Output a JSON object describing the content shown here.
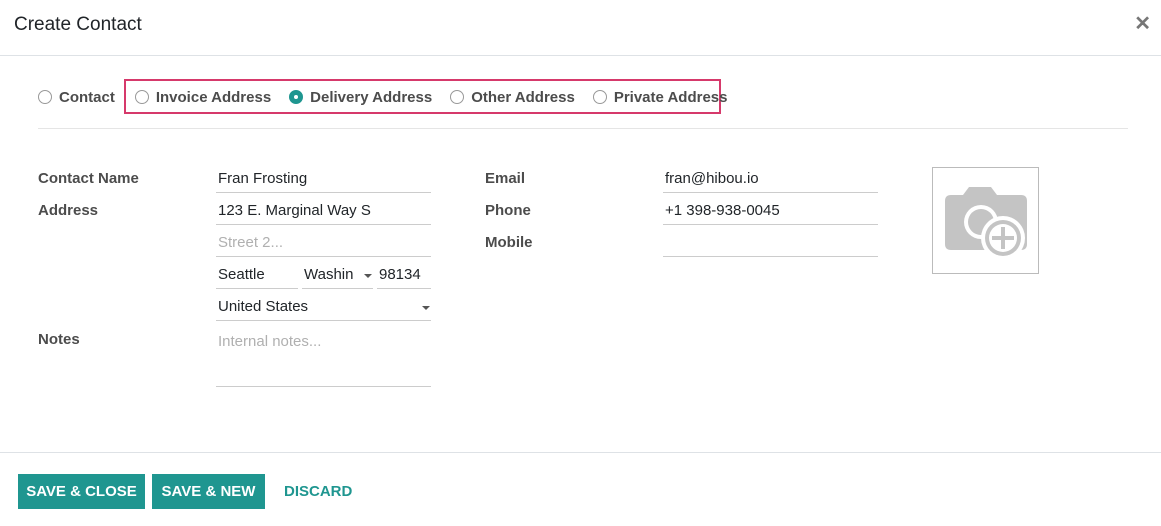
{
  "dialog": {
    "title": "Create Contact",
    "close_icon": "close-icon"
  },
  "address_types": [
    {
      "label": "Contact",
      "checked": false
    },
    {
      "label": "Invoice Address",
      "checked": false
    },
    {
      "label": "Delivery Address",
      "checked": true
    },
    {
      "label": "Other Address",
      "checked": false
    },
    {
      "label": "Private Address",
      "checked": false
    }
  ],
  "form": {
    "contact_name_label": "Contact Name",
    "contact_name": "Fran Frosting",
    "address_label": "Address",
    "street": "123 E. Marginal Way S",
    "street2_placeholder": "Street 2...",
    "city": "Seattle",
    "state": "Washin",
    "zip": "98134",
    "country": "United States",
    "notes_label": "Notes",
    "notes_placeholder": "Internal notes...",
    "email_label": "Email",
    "email": "fran@hibou.io",
    "phone_label": "Phone",
    "phone": "+1 398-938-0045",
    "mobile_label": "Mobile",
    "mobile": "",
    "photo_icon": "camera-plus-icon"
  },
  "footer": {
    "save_close": "SAVE & CLOSE",
    "save_new": "SAVE & NEW",
    "discard": "DISCARD"
  },
  "colors": {
    "accent": "#1f9690",
    "highlight_border": "#d6396b"
  }
}
